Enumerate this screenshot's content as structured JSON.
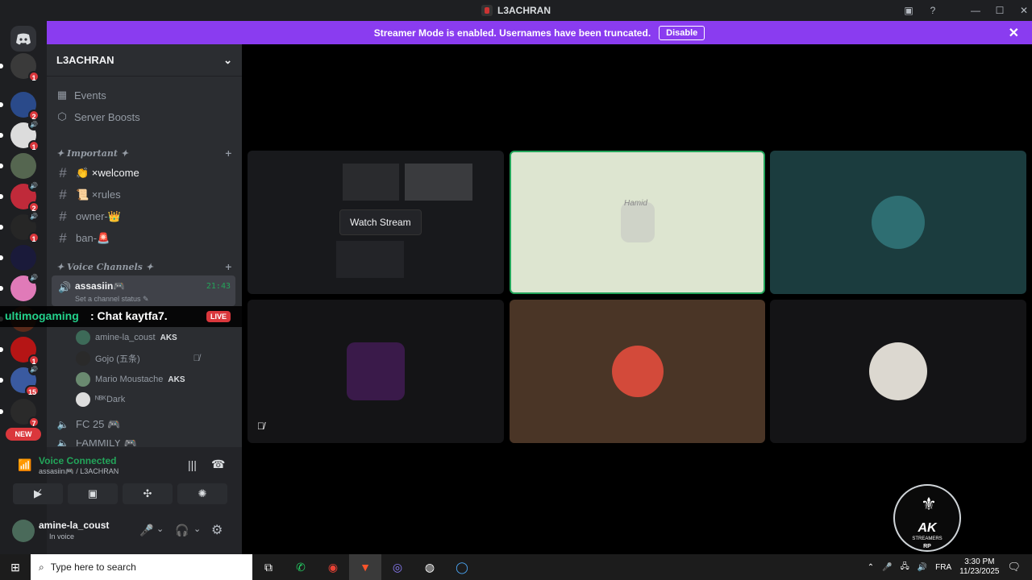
{
  "window": {
    "title": "L3ACHRAN",
    "controls": [
      "—",
      "☐",
      "✕"
    ]
  },
  "banner": {
    "text": "Streamer Mode is enabled. Usernames have been truncated.",
    "disable_label": "Disable"
  },
  "guilds": [
    {
      "badge": "1",
      "color": "#3a3a3a",
      "dot": true
    },
    {
      "badge": "2",
      "color": "#2a4a8a",
      "dot": true
    },
    {
      "badge": "1",
      "color": "#dcdcdc",
      "dot": true,
      "speaker": true
    },
    {
      "badge": "",
      "color": "#556650",
      "dot": true
    },
    {
      "badge": "2",
      "color": "#c02a3a",
      "dot": true,
      "speaker": true
    },
    {
      "badge": "1",
      "color": "#262626",
      "dot": true,
      "speaker": true
    },
    {
      "badge": "",
      "color": "#1a1a3a",
      "dot": true
    },
    {
      "badge": "",
      "color": "#e07ab8",
      "dot": true,
      "speaker": true
    },
    {
      "badge": "",
      "color": "#5a2a1a",
      "dot": true
    },
    {
      "badge": "1",
      "color": "#b51515",
      "dot": true
    },
    {
      "badge": "15",
      "color": "#3a5aa0",
      "dot": true,
      "speaker": true
    },
    {
      "badge": "7",
      "color": "#2a2a2a",
      "dot": true
    }
  ],
  "guilds_new_label": "NEW",
  "server": {
    "name": "L3ACHRAN"
  },
  "nav": {
    "events": "Events",
    "boosts": "Server Boosts"
  },
  "categories": {
    "important": "✦ Important ✦",
    "voice": "✦ Voice Channels ✦"
  },
  "text_channels": [
    "👏 ×welcome",
    "📜 ×rules",
    "owner-👑",
    "ban-🚨"
  ],
  "voice_channel": {
    "name": "assasiin🎮",
    "time": "21:43",
    "status": "Set a channel status ✎"
  },
  "voice_users": [
    {
      "name": "amine-la_coust",
      "tag": "AKS"
    },
    {
      "name": "Gojo (五条)",
      "tag": ""
    },
    {
      "name": "Mario Moustache",
      "tag": "AKS"
    },
    {
      "name": "ᴺᴮᴷDark",
      "tag": ""
    }
  ],
  "other_channels": [
    "FC 25 🎮",
    "FAMMILY 🎮"
  ],
  "overlay": {
    "user": "ultimogaming",
    "msg": ": Chat kaytfa7.",
    "live": "LIVE"
  },
  "voice_panel": {
    "title": "Voice Connected",
    "sub": "assasiin🎮 / L3ACHRAN"
  },
  "me": {
    "name": "amine-la_coust",
    "status": "In voice"
  },
  "stream": {
    "watch_label": "Watch Stream"
  },
  "tile_names": {
    "hamid": "Hamid"
  },
  "taskbar": {
    "search_placeholder": "Type here to search",
    "lang": "FRA",
    "time": "3:30 PM",
    "date": "11/23/2025"
  },
  "logo": {
    "ak": "AK",
    "sub": "STREAMERS",
    "rp": "RP"
  }
}
